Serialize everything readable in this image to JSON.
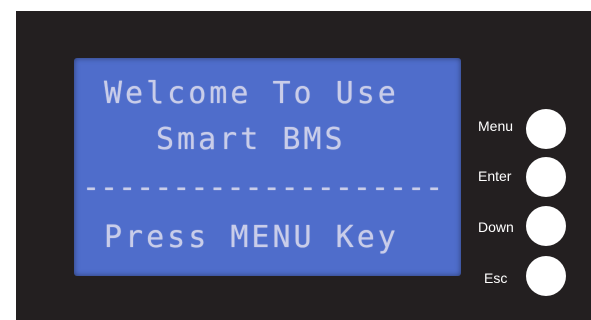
{
  "lcd": {
    "line1": "Welcome To Use",
    "line2": "Smart BMS",
    "line3": "--------------------",
    "line4": "Press MENU Key"
  },
  "keys": {
    "menu_label": "Menu",
    "enter_label": "Enter",
    "down_label": "Down",
    "esc_label": "Esc"
  },
  "colors": {
    "panel": "#231f20",
    "lcd_background": "#4f6dcb",
    "lcd_text": "#c9cde9",
    "button": "#ffffff"
  }
}
